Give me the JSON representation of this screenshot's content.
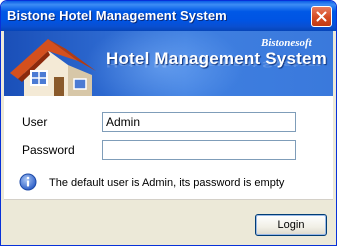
{
  "window": {
    "title": "Bistone Hotel Management System",
    "close_icon": "close-icon"
  },
  "banner": {
    "title": "Hotel Management System",
    "brand": "Bistonesoft",
    "logo_icon": "house-icon"
  },
  "form": {
    "user_label": "User",
    "user_value": "Admin",
    "password_label": "Password",
    "password_value": ""
  },
  "info": {
    "icon": "info-icon",
    "message": "The default user is Admin, its password is empty"
  },
  "footer": {
    "login_label": "Login"
  },
  "colors": {
    "titlebar": "#0054e3",
    "banner": "#2c68cf",
    "close_button": "#d44b22",
    "info_icon": "#3a6fd8"
  }
}
